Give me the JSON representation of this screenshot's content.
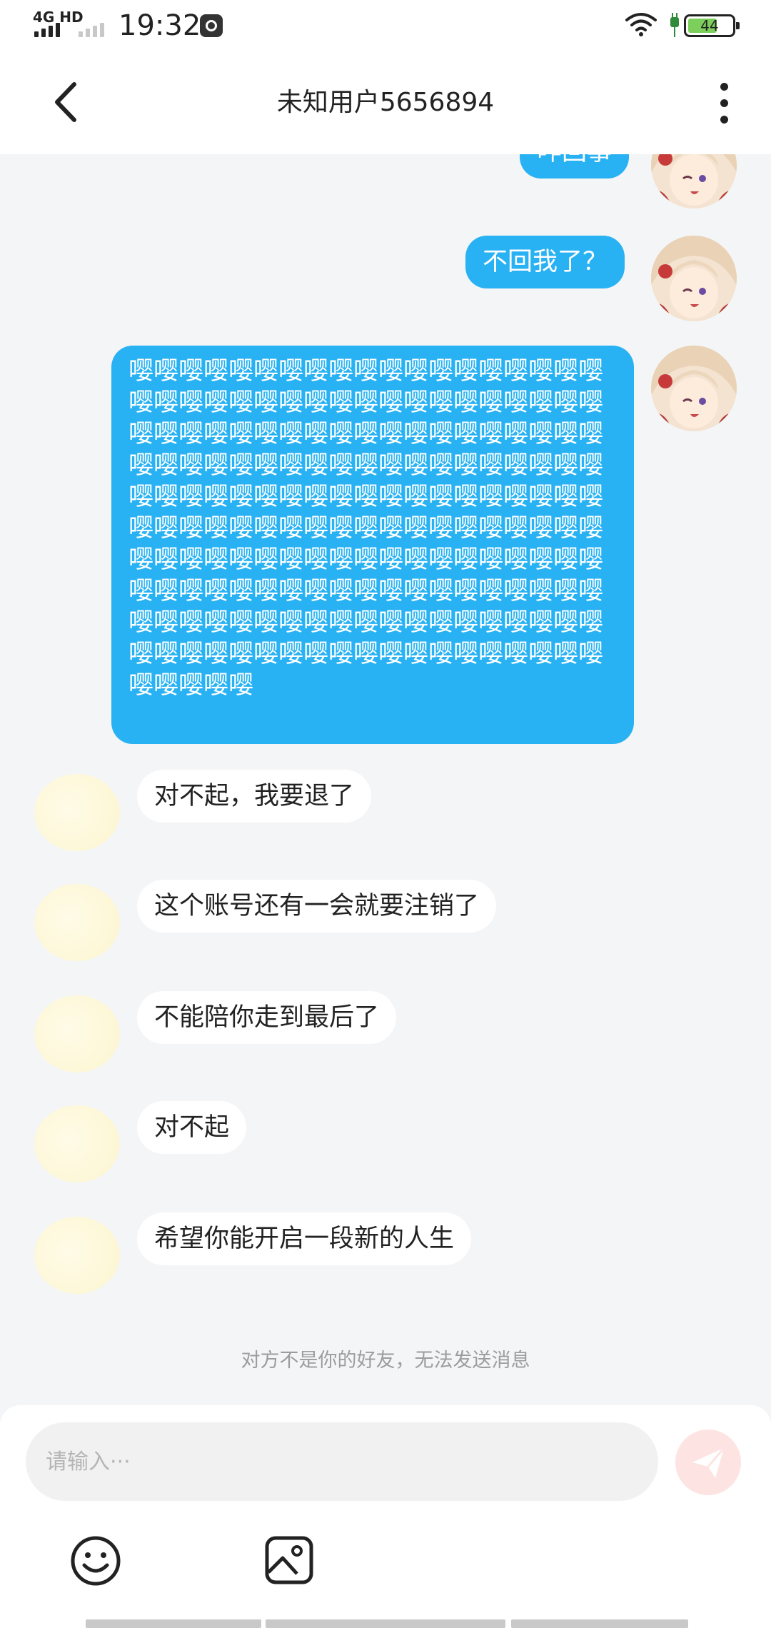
{
  "status_bar": {
    "network": "4G HD",
    "time": "19:32",
    "battery": "44"
  },
  "header": {
    "title": "未知用户5656894",
    "back_icon": "chevron-left-icon",
    "more_icon": "vertical-dots-icon"
  },
  "messages_sent": [
    {
      "text": "咋回事"
    },
    {
      "text": "不回我了？"
    },
    {
      "text": "嘤嘤嘤嘤嘤嘤嘤嘤嘤嘤嘤嘤嘤嘤嘤嘤嘤嘤嘤嘤嘤嘤嘤嘤嘤嘤嘤嘤嘤嘤嘤嘤嘤嘤嘤嘤嘤嘤嘤嘤嘤嘤嘤嘤嘤嘤嘤嘤嘤嘤嘤嘤嘤嘤嘤嘤嘤嘤嘤嘤嘤嘤嘤嘤嘤嘤嘤嘤嘤嘤嘤嘤嘤嘤嘤嘤嘤嘤嘤嘤嘤嘤嘤嘤嘤嘤嘤嘤嘤嘤嘤嘤嘤嘤嘤嘤嘤嘤嘤嘤嘤嘤嘤嘤嘤嘤嘤嘤嘤嘤嘤嘤嘤嘤嘤嘤嘤嘤嘤嘤嘤嘤嘤嘤嘤嘤嘤嘤嘤嘤嘤嘤嘤嘤嘤嘤嘤嘤嘤嘤嘤嘤嘤嘤嘤嘤嘤嘤嘤嘤嘤嘤嘤嘤嘤嘤嘤嘤嘤嘤嘤嘤嘤嘤嘤嘤嘤嘤嘤嘤嘤嘤嘤嘤嘤嘤嘤嘤嘤嘤嘤嘤嘤嘤嘤嘤嘤嘤嘤嘤嘤嘤嘤嘤嘤"
    }
  ],
  "messages_received": [
    {
      "text": "对不起，我要退了"
    },
    {
      "text": "这个账号还有一会就要注销了"
    },
    {
      "text": "不能陪你走到最后了"
    },
    {
      "text": "对不起"
    },
    {
      "text": "希望你能开启一段新的人生"
    }
  ],
  "notice": "对方不是你的好友，无法发送消息",
  "composer": {
    "placeholder": "请输入···",
    "send_icon": "paper-plane-icon",
    "emoji_icon": "smiley-icon",
    "image_icon": "image-icon"
  },
  "colors": {
    "sent_bubble": "#29b2f3",
    "received_bubble": "#ffffff",
    "background": "#f4f5f7",
    "send_button": "#fde4e2"
  }
}
